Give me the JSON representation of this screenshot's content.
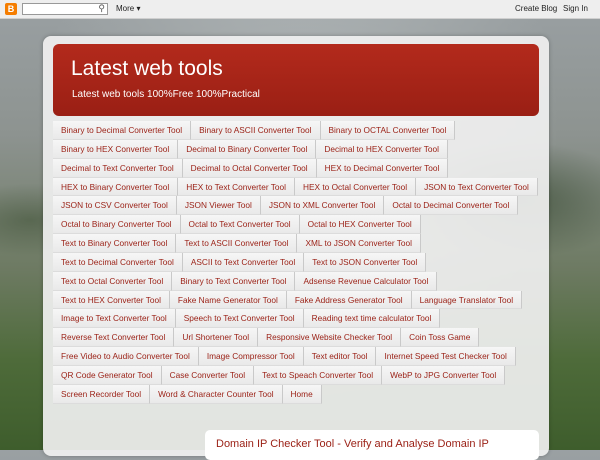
{
  "navbar": {
    "logo": "B",
    "search": {
      "value": "",
      "placeholder": ""
    },
    "more_label": "More ▾",
    "create_blog": "Create Blog",
    "sign_in": "Sign In"
  },
  "header": {
    "title": "Latest web tools",
    "description": "Latest web tools 100%Free 100%Practical"
  },
  "tabs": [
    "Binary to Decimal Converter Tool",
    "Binary to ASCII Converter Tool",
    "Binary to OCTAL Converter Tool",
    "Binary to HEX Converter Tool",
    "Decimal to Binary Converter Tool",
    "Decimal to HEX Converter Tool",
    "Decimal to Text Converter Tool",
    "Decimal to Octal Converter Tool",
    "HEX to Decimal Converter Tool",
    "HEX to Binary Converter Tool",
    "HEX to Text Converter Tool",
    "HEX to Octal Converter Tool",
    "JSON to Text Converter Tool",
    "JSON to CSV Converter Tool",
    "JSON Viewer Tool",
    "JSON to XML Converter Tool",
    "Octal to Decimal Converter Tool",
    "Octal to Binary Converter Tool",
    "Octal to Text Converter Tool",
    "Octal to HEX Converter Tool",
    "Text to Binary Converter Tool",
    "Text to ASCII Converter Tool",
    "XML to JSON Converter Tool",
    "Text to Decimal Converter Tool",
    "ASCII to Text Converter Tool",
    "Text to JSON Converter Tool",
    "Text to Octal Converter Tool",
    "Binary to Text Converter Tool",
    "Adsense Revenue Calculator Tool",
    "Text to HEX Converter Tool",
    "Fake Name Generator Tool",
    "Fake Address Generator Tool",
    "Language Translator Tool",
    "Image to Text Converter Tool",
    "Speech to Text Converter Tool",
    "Reading text time calculator Tool",
    "Reverse Text Converter Tool",
    "Url Shortener Tool",
    "Responsive Website Checker Tool",
    "Coin Toss Game",
    "Free Video to Audio Converter Tool",
    "Image Compressor Tool",
    "Text editor Tool",
    "Internet Speed Test Checker Tool",
    "QR Code Generator Tool",
    "Case Converter Tool",
    "Text to Speach Converter Tool",
    "WebP to JPG Converter Tool",
    "Screen Recorder Tool",
    "Word & Character Counter Tool",
    "Home"
  ],
  "post": {
    "title": "Domain IP Checker Tool - Verify and Analyse Domain IP"
  }
}
